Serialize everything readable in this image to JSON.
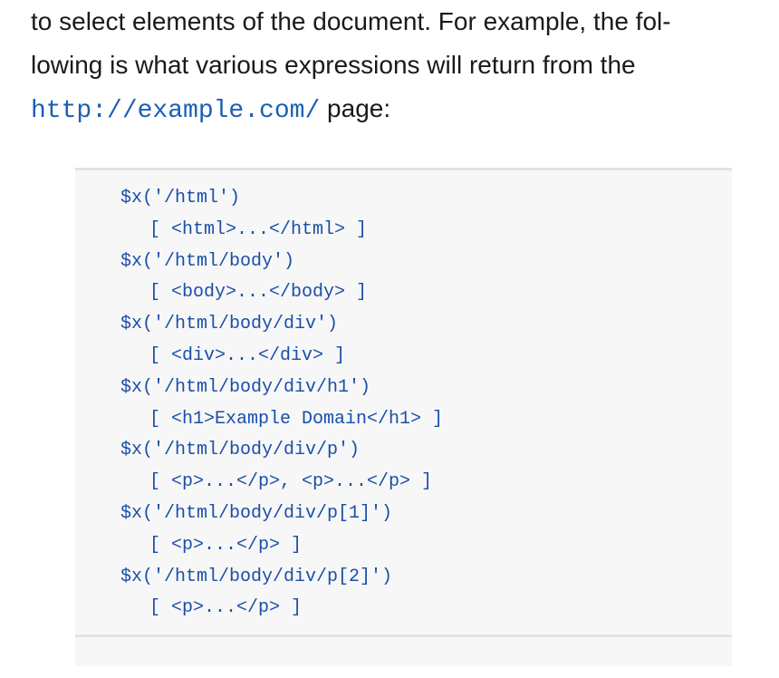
{
  "paragraph": {
    "line1": "to select elements of the document. For example, the fol-",
    "line2": "lowing is what various expressions will return from the",
    "line3_code": "http://example.com/",
    "line3_text": " page:"
  },
  "code_lines": [
    {
      "text": "$x('/html')",
      "result": false
    },
    {
      "text": "[ <html>...</html> ]",
      "result": true
    },
    {
      "text": "$x('/html/body')",
      "result": false
    },
    {
      "text": "[ <body>...</body> ]",
      "result": true
    },
    {
      "text": "$x('/html/body/div')",
      "result": false
    },
    {
      "text": "[ <div>...</div> ]",
      "result": true
    },
    {
      "text": "$x('/html/body/div/h1')",
      "result": false
    },
    {
      "text": "[ <h1>Example Domain</h1> ]",
      "result": true
    },
    {
      "text": "$x('/html/body/div/p')",
      "result": false
    },
    {
      "text": "[ <p>...</p>, <p>...</p> ]",
      "result": true
    },
    {
      "text": "$x('/html/body/div/p[1]')",
      "result": false
    },
    {
      "text": "[ <p>...</p> ]",
      "result": true
    },
    {
      "text": "$x('/html/body/div/p[2]')",
      "result": false
    },
    {
      "text": "[ <p>...</p> ]",
      "result": true
    }
  ]
}
